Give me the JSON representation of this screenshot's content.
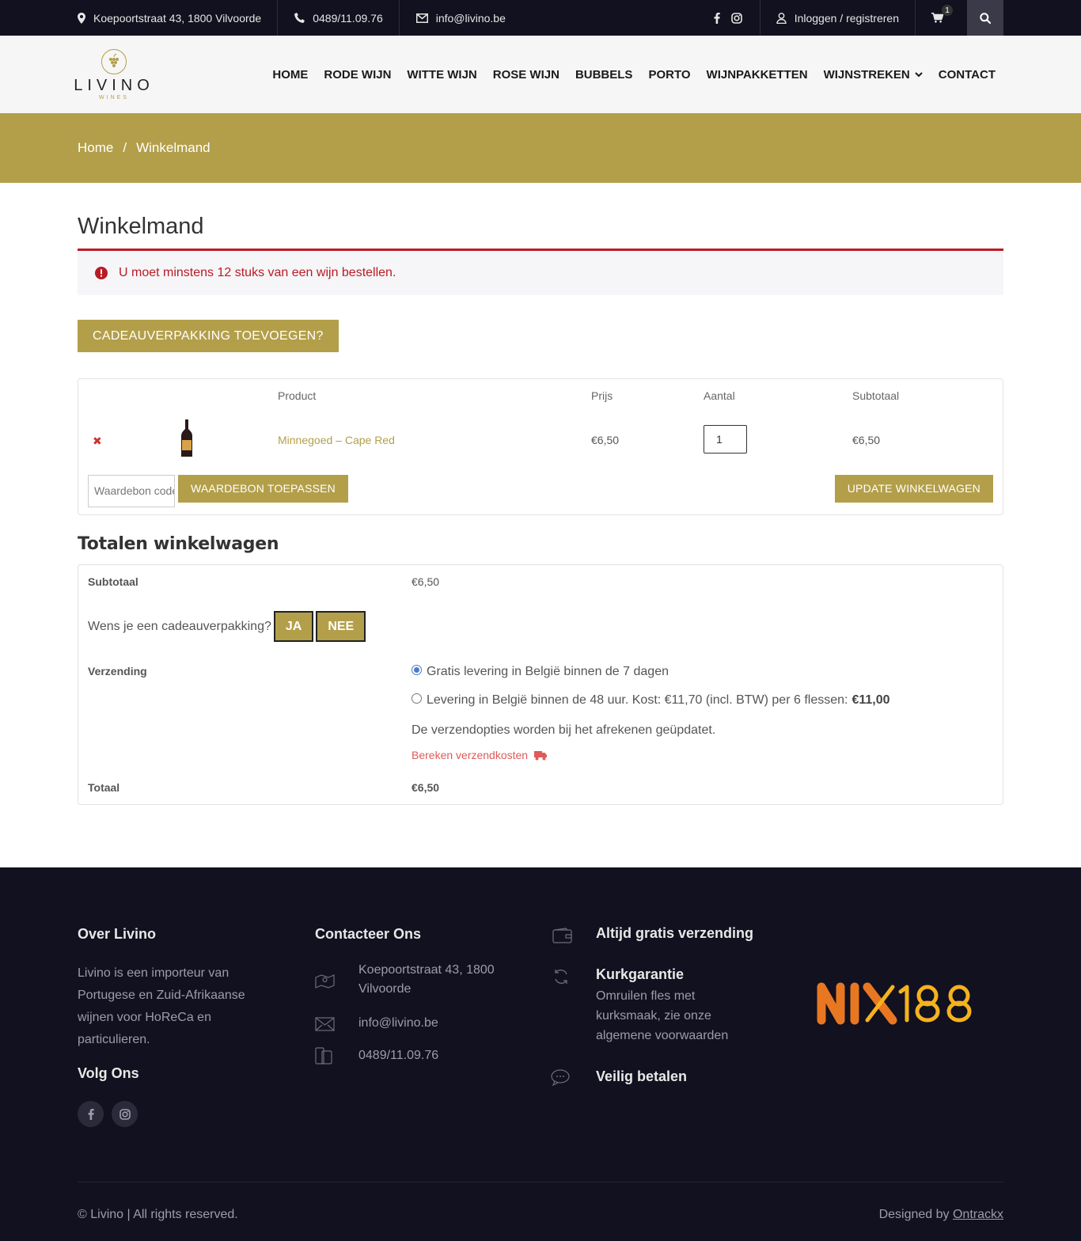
{
  "topbar": {
    "address": "Koepoortstraat 43, 1800 Vilvoorde",
    "phone": "0489/11.09.76",
    "email": "info@livino.be",
    "login": "Inloggen / registreren",
    "cart_count": "1"
  },
  "header": {
    "logo_name": "LIVINO",
    "logo_sub": "WINES",
    "nav": [
      "HOME",
      "RODE WIJN",
      "WITTE WIJN",
      "ROSE WIJN",
      "BUBBELS",
      "PORTO",
      "WIJNPAKKETTEN",
      "WIJNSTREKEN",
      "CONTACT"
    ]
  },
  "breadcrumb": {
    "home": "Home",
    "sep": "/",
    "current": "Winkelmand"
  },
  "main": {
    "title": "Winkelmand",
    "notice": "U moet minstens 12 stuks van een wijn bestellen.",
    "gift_button": "CADEAUVERPAKKING TOEVOEGEN?"
  },
  "cart": {
    "headers": {
      "product": "Product",
      "price": "Prijs",
      "qty": "Aantal",
      "subtotal": "Subtotaal"
    },
    "row": {
      "name": "Minnegoed – Cape Red",
      "price": "€6,50",
      "qty": "1",
      "subtotal": "€6,50"
    },
    "coupon_placeholder": "Waardebon code",
    "apply_button": "WAARDEBON TOEPASSEN",
    "update_button": "UPDATE WINKELWAGEN"
  },
  "totals": {
    "title": "Totalen winkelwagen",
    "subtotal_label": "Subtotaal",
    "subtotal_value": "€6,50",
    "gift_question": "Wens je een cadeauverpakking?",
    "yes": "JA",
    "no": "NEE",
    "shipping_label": "Verzending",
    "shipping_option_1": "Gratis levering in België binnen de 7 dagen",
    "shipping_option_2": "Levering in België binnen de 48 uur. Kost: €11,70 (incl. BTW) per 6 flessen: ",
    "shipping_option_2_price": "€11,00",
    "shipping_note": "De verzendopties worden bij het afrekenen geüpdatet.",
    "calculate": "Bereken verzendkosten",
    "total_label": "Totaal",
    "total_value": "€6,50"
  },
  "footer": {
    "about_title": "Over Livino",
    "about_text": "Livino is een importeur van Portugese en Zuid-Afrikaanse wijnen voor HoReCa en particulieren.",
    "follow_title": "Volg Ons",
    "contact_title": "Contacteer Ons",
    "contact_address": "Koepoortstraat 43, 1800 Vilvoorde",
    "contact_email": "info@livino.be",
    "contact_phone": "0489/11.09.76",
    "feature_1": "Altijd gratis verzending",
    "feature_2": "Kurkgarantie",
    "feature_2_text": "Omruilen fles met kurksmaak, zie onze algemene voorwaarden",
    "feature_3": "Veilig betalen",
    "nix_logo": "NIX18",
    "copyright": "© Livino | All rights reserved.",
    "designed_by": "Designed by ",
    "designer": "Ontrackx"
  },
  "colors": {
    "gold": "#b39f4a",
    "dark": "#11111f",
    "error": "#b81c23"
  }
}
